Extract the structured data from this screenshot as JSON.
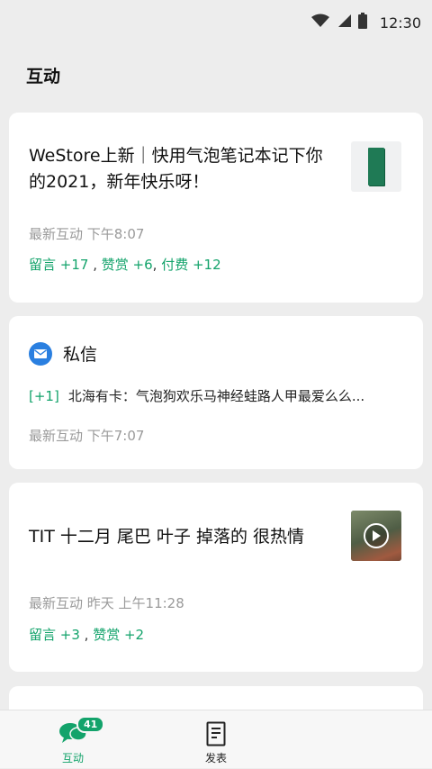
{
  "status_bar": {
    "time": "12:30",
    "icons": [
      "wifi-icon",
      "signal-icon",
      "battery-icon"
    ]
  },
  "page": {
    "title": "互动"
  },
  "cards": [
    {
      "title": "WeStore上新｜快用气泡笔记本记下你的2021，新年快乐呀！",
      "latest": "最新互动  下午8:07",
      "stats": {
        "comments": "留言 +17",
        "likes": "赞赏 +6",
        "paid": "付费 +12"
      },
      "thumbnail": "green-notebook-thumbnail"
    },
    {
      "title": "私信",
      "count": "[+1]",
      "message": "北海有卡：气泡狗欢乐马神经蛙路人甲最爱么么...",
      "latest": "最新互动   下午7:07",
      "icon": "mail-icon"
    },
    {
      "title": "TIT 十二月 尾巴 叶子 掉落的 很热情",
      "latest": "最新互动 昨天 上午11:28",
      "stats": {
        "comments": "留言 +3",
        "likes": "赞赏 +2"
      },
      "thumbnail": "video-thumbnail"
    }
  ],
  "tabbar": {
    "tabs": [
      {
        "label": "互动",
        "badge": "41",
        "icon": "chat-bubbles-icon",
        "active": true
      },
      {
        "label": "发表",
        "icon": "document-icon",
        "active": false
      }
    ]
  },
  "colors": {
    "accent": "#13a36b",
    "background": "#ededed",
    "card": "#ffffff",
    "dm_icon": "#2a7fe0"
  }
}
